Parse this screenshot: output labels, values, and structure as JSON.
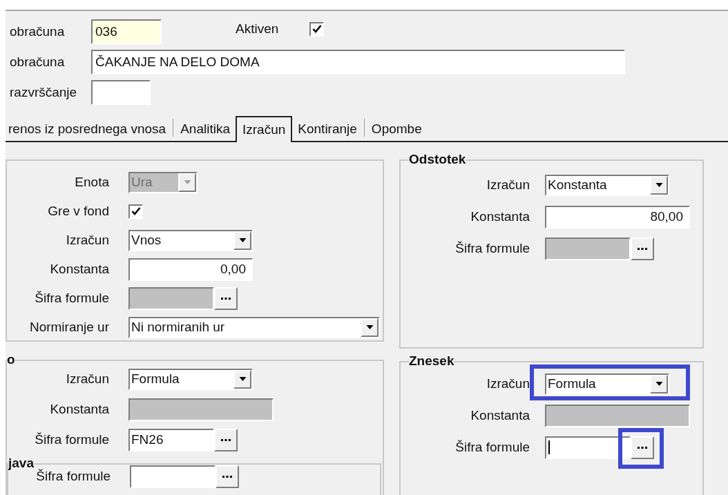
{
  "header": {
    "rows": [
      {
        "label": "obračuna",
        "value": "036",
        "required": true,
        "check": {
          "label": "Aktiven",
          "checked": true
        }
      },
      {
        "label": "obračuna",
        "value": "ČAKANJE NA DELO DOMA",
        "required": false
      },
      {
        "label": "razvrščanje",
        "required": false
      }
    ]
  },
  "tabs": [
    {
      "label": "renos iz posrednega vnosa",
      "selected": false
    },
    {
      "label": "Analitika",
      "selected": false
    },
    {
      "label": "Izračun",
      "selected": true
    },
    {
      "label": "Kontiranje",
      "selected": false
    },
    {
      "label": "Opombe",
      "selected": false
    }
  ],
  "columns": [
    [
      {
        "rows": [
          {
            "label": "Enota",
            "kind": "combo",
            "value": "Ura",
            "disabled": true,
            "highlighted": false
          },
          {
            "label": "Gre v fond",
            "kind": "checkbox",
            "checked": true,
            "highlighted": false
          },
          {
            "label": "Izračun",
            "kind": "combo",
            "value": "Vnos",
            "disabled": false,
            "highlighted": false
          },
          {
            "label": "Konstanta",
            "kind": "number",
            "value": "0,00",
            "disabled": false,
            "highlighted": false
          },
          {
            "label": "Šifra formule",
            "kind": "lookup",
            "disabled": true,
            "focused": false,
            "highlighted": false
          },
          {
            "label": "Normiranje ur",
            "kind": "combo",
            "value": "Ni normiranih ur",
            "disabled": false,
            "highlighted": false
          }
        ]
      },
      {
        "title": "o",
        "rows": [
          {
            "label": "Izračun",
            "kind": "combo",
            "value": "Formula",
            "disabled": false,
            "highlighted": false
          },
          {
            "label": "Konstanta",
            "kind": "number",
            "disabled": true,
            "highlighted": false
          },
          {
            "label": "Šifra formule",
            "kind": "lookup",
            "value": "FN26",
            "disabled": false,
            "focused": false,
            "highlighted": false
          }
        ],
        "subpanel": {
          "title": "java",
          "rows": [
            {
              "label": "Šifra formule",
              "kind": "lookup",
              "disabled": false,
              "focused": false,
              "highlighted": false
            }
          ]
        }
      }
    ],
    [
      {
        "title": "Odstotek",
        "rows": [
          {
            "label": "Izračun",
            "kind": "combo",
            "value": "Konstanta",
            "disabled": false,
            "highlighted": false
          },
          {
            "label": "Konstanta",
            "kind": "number",
            "value": "80,00",
            "disabled": false,
            "highlighted": false
          },
          {
            "label": "Šifra formule",
            "kind": "lookup",
            "disabled": true,
            "focused": false,
            "highlighted": false
          }
        ]
      },
      {
        "title": "Znesek",
        "rows": [
          {
            "label": "Izračun",
            "kind": "combo",
            "value": "Formula",
            "disabled": false,
            "highlighted": true
          },
          {
            "label": "Konstanta",
            "kind": "number",
            "disabled": true,
            "highlighted": false
          },
          {
            "label": "Šifra formule",
            "kind": "lookup",
            "disabled": false,
            "focused": true,
            "highlighted": true
          }
        ]
      }
    ]
  ]
}
